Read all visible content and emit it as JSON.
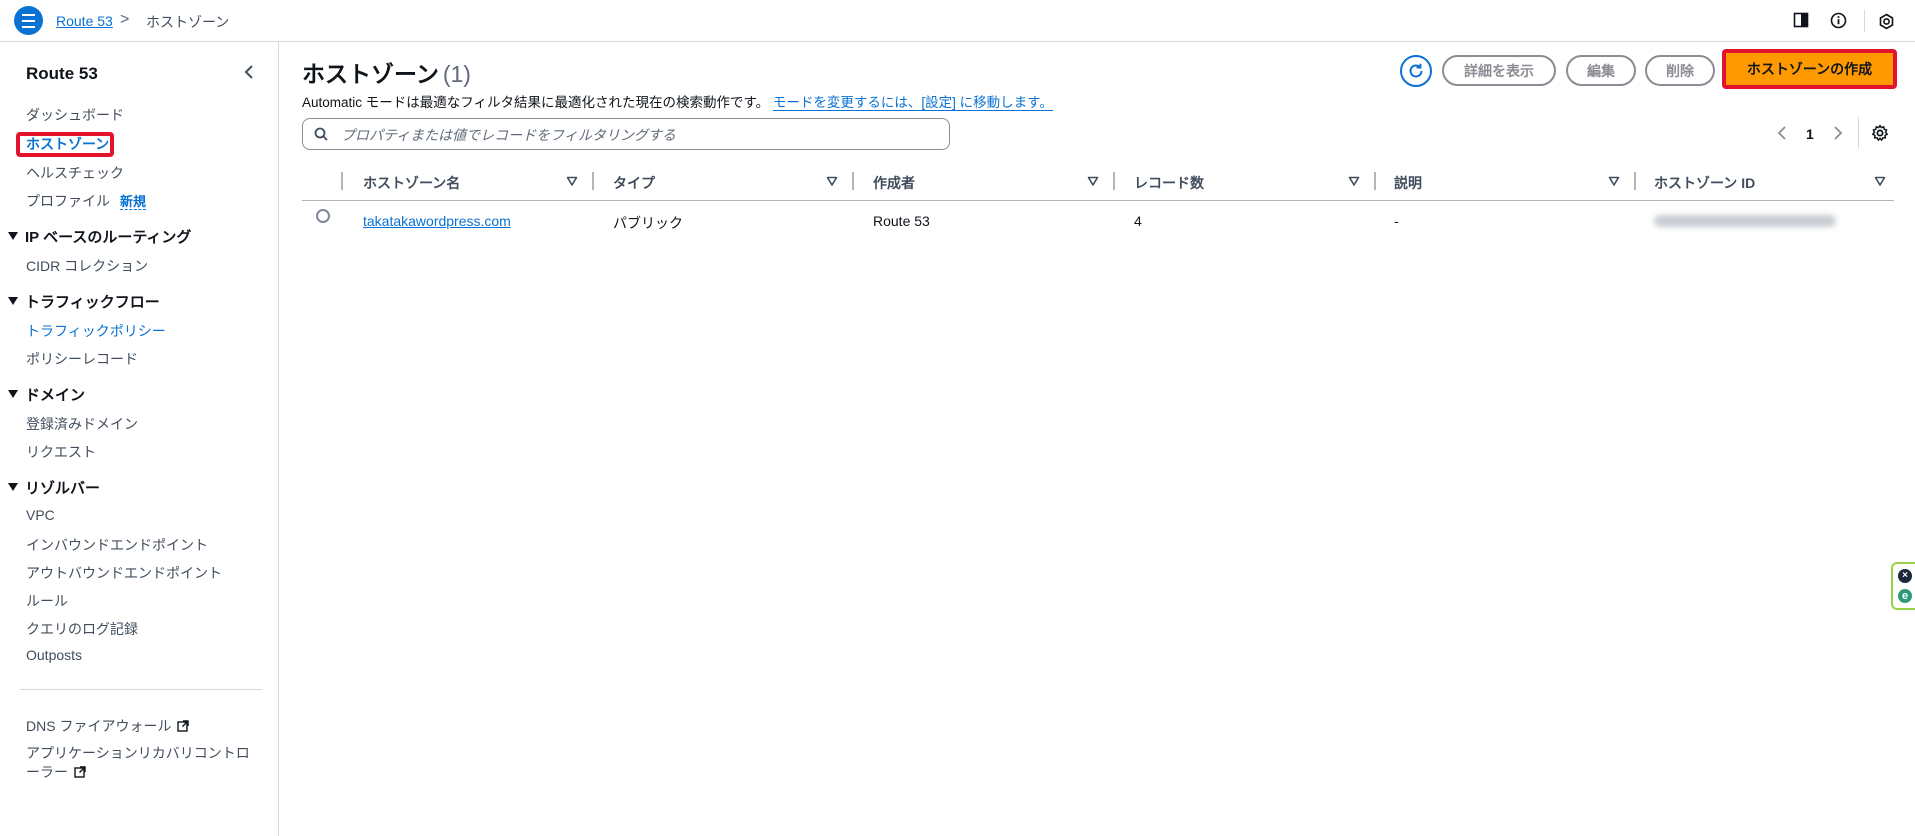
{
  "topbar": {
    "breadcrumb_root": "Route 53",
    "breadcrumb_sep": ">",
    "breadcrumb_current": "ホストゾーン"
  },
  "sidebar": {
    "title": "Route 53",
    "items_top": [
      "ダッシュボード",
      "ホストゾーン",
      "ヘルスチェック",
      "プロファイル"
    ],
    "new_badge": "新規",
    "sections": [
      {
        "title": "IP ベースのルーティング",
        "items": [
          "CIDR コレクション"
        ]
      },
      {
        "title": "トラフィックフロー",
        "items": [
          "トラフィックポリシー",
          "ポリシーレコード"
        ]
      },
      {
        "title": "ドメイン",
        "items": [
          "登録済みドメイン",
          "リクエスト"
        ]
      },
      {
        "title": "リゾルバー",
        "items": [
          "VPC",
          "インバウンドエンドポイント",
          "アウトバウンドエンドポイント",
          "ルール",
          "クエリのログ記録",
          "Outposts"
        ]
      }
    ],
    "footer_items": [
      "DNS ファイアウォール",
      "アプリケーションリカバリコントロ",
      "ーラー"
    ]
  },
  "main": {
    "title": "ホストゾーン",
    "count": "(1)",
    "description": "Automatic モードは最適なフィルタ結果に最適化された現在の検索動作です。",
    "description_link": "モードを変更するには、[設定] に移動します。",
    "buttons": {
      "details": "詳細を表示",
      "edit": "編集",
      "delete": "削除",
      "create": "ホストゾーンの作成"
    },
    "search_placeholder": "プロパティまたは値でレコードをフィルタリングする",
    "pagination": {
      "current_page": "1"
    }
  },
  "table": {
    "columns": [
      "ホストゾーン名",
      "タイプ",
      "作成者",
      "レコード数",
      "説明",
      "ホストゾーン ID"
    ],
    "rows": [
      {
        "name": "takatakawordpress.com",
        "type": "パブリック",
        "created_by": "Route 53",
        "record_count": "4",
        "description": "-",
        "zone_id": ""
      }
    ]
  },
  "colors": {
    "accent": "#0972d3",
    "primary_button": "#ff9900",
    "highlight": "#e3122d"
  }
}
